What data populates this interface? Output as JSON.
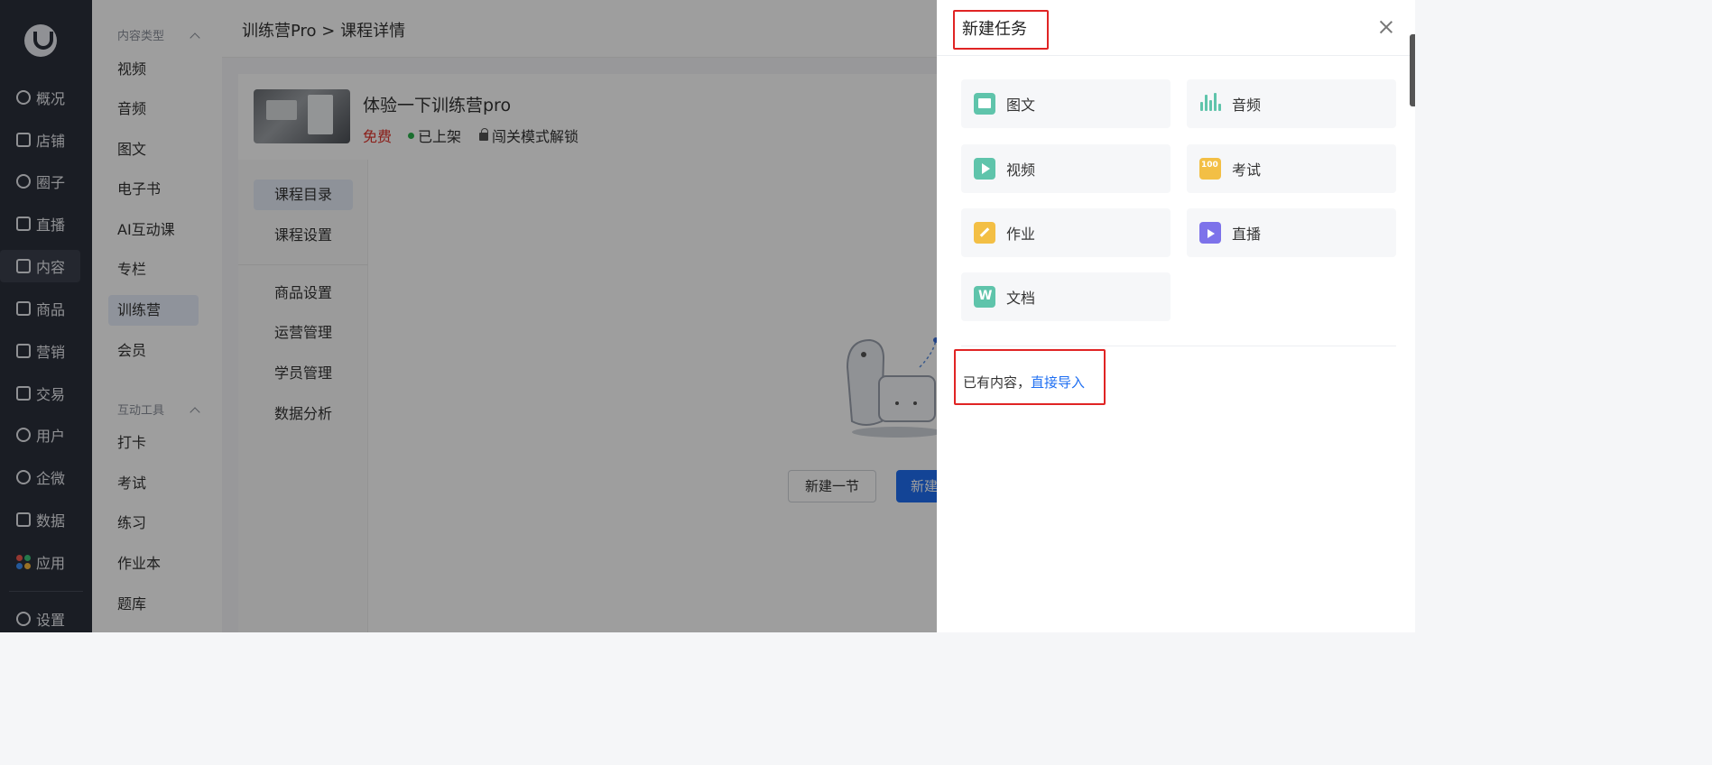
{
  "nav": {
    "items": [
      {
        "label": "概况",
        "icon": "clock-icon"
      },
      {
        "label": "店铺",
        "icon": "store-icon"
      },
      {
        "label": "圈子",
        "icon": "people-icon"
      },
      {
        "label": "直播",
        "icon": "live-icon"
      },
      {
        "label": "内容",
        "icon": "book-icon",
        "active": true
      },
      {
        "label": "商品",
        "icon": "bag-icon"
      },
      {
        "label": "营销",
        "icon": "megaphone-icon"
      },
      {
        "label": "交易",
        "icon": "receipt-icon"
      },
      {
        "label": "用户",
        "icon": "user-icon"
      },
      {
        "label": "企微",
        "icon": "chat-icon"
      },
      {
        "label": "数据",
        "icon": "chart-icon"
      },
      {
        "label": "应用",
        "icon": "apps-icon"
      },
      {
        "label": "设置",
        "icon": "gear-icon"
      }
    ]
  },
  "submenu": {
    "group1": "内容类型",
    "items1": [
      "视频",
      "音频",
      "图文",
      "电子书",
      "AI互动课",
      "专栏",
      "训练营",
      "会员"
    ],
    "group2": "互动工具",
    "items2": [
      "打卡",
      "考试",
      "练习",
      "作业本",
      "题库"
    ],
    "active": "训练营"
  },
  "breadcrumb": "训练营Pro > 课程详情",
  "course": {
    "title": "体验一下训练营pro",
    "price": "免费",
    "status": "已上架",
    "unlock": "闯关模式解锁"
  },
  "tabs": [
    "课程目录",
    "课程设置",
    "商品设置",
    "运营管理",
    "学员管理",
    "数据分析"
  ],
  "buttons": {
    "new_section": "新建一节",
    "new_primary": "新建"
  },
  "drawer": {
    "title": "新建任务",
    "task_types": [
      {
        "label": "图文",
        "icon": "image-icon",
        "color": "#5fc4ab"
      },
      {
        "label": "音频",
        "icon": "audio-wave-icon",
        "color": "#5fc4ab"
      },
      {
        "label": "视频",
        "icon": "video-play-icon",
        "color": "#5fc4ab"
      },
      {
        "label": "考试",
        "icon": "exam-100-icon",
        "color": "#f3bf45"
      },
      {
        "label": "作业",
        "icon": "homework-pen-icon",
        "color": "#f3bf45"
      },
      {
        "label": "直播",
        "icon": "live-tv-icon",
        "color": "#7d72ea"
      },
      {
        "label": "文档",
        "icon": "document-w-icon",
        "color": "#5fc4ab"
      }
    ],
    "import_prefix": "已有内容，",
    "import_link": "直接导入"
  },
  "colors": {
    "nav_bg": "#2b2f3a",
    "primary": "#1f6ff2",
    "highlight_box": "#e02424",
    "free_price": "#e0322a",
    "listed_dot": "#2bb24c"
  }
}
